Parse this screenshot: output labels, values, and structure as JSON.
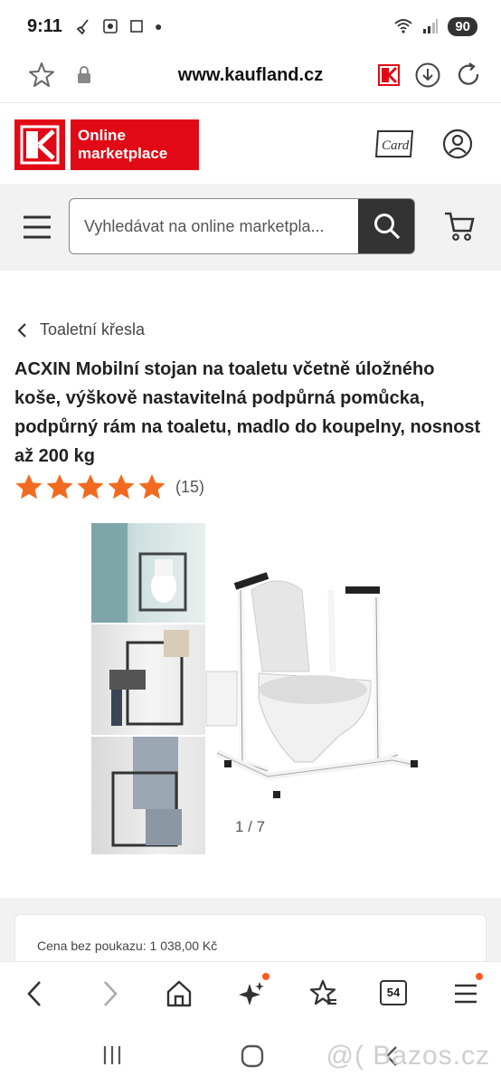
{
  "status_bar": {
    "time": "9:11",
    "battery": "90"
  },
  "browser": {
    "url": "www.kaufland.cz"
  },
  "header": {
    "logo_text_line1": "Online",
    "logo_text_line2": "marketplace",
    "card_label": "Card",
    "brand_color": "#e10915"
  },
  "search": {
    "placeholder": "Vyhledávat na online marketpla..."
  },
  "breadcrumb": {
    "label": "Toaletní křesla"
  },
  "product": {
    "title": "ACXIN Mobilní stojan na toaletu včetně úložného koše, výškově nastavitelná podpůrná pomůcka, podpůrný rám na toaletu, madlo do koupelny, nosnost až 200 kg",
    "rating_stars": 5,
    "rating_count": "(15)",
    "star_color": "#f26a1f",
    "image_counter": "1 / 7"
  },
  "price": {
    "label": "Cena bez poukazu: 1 038,00 Kč"
  },
  "toolbar": {
    "tabs_count": "54"
  },
  "watermark": {
    "text": "@( Bazos.cz"
  }
}
